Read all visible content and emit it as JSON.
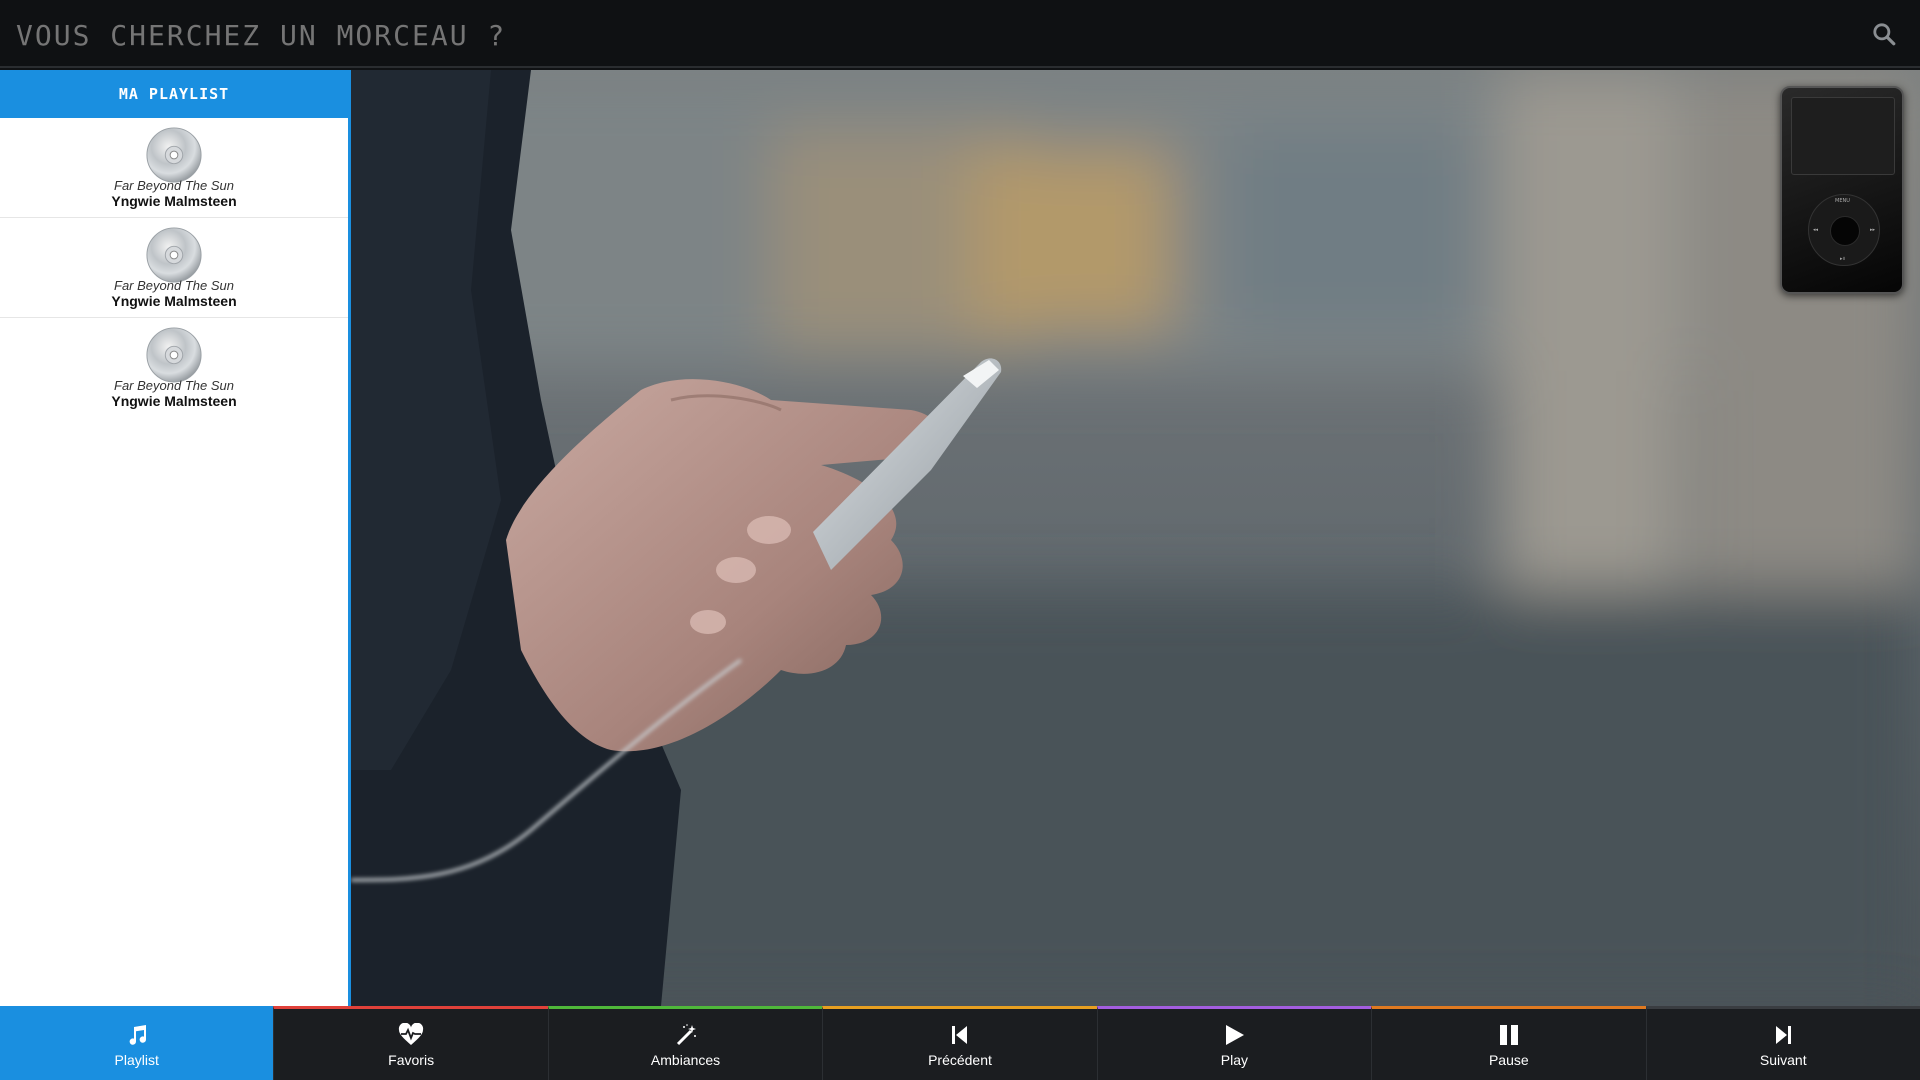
{
  "header": {
    "search_placeholder": "VOUS CHERCHEZ UN MORCEAU ?",
    "search_icon": "search-icon"
  },
  "sidebar": {
    "title": "Ma playlist",
    "tracks": [
      {
        "title": "Far Beyond The Sun",
        "artist": "Yngwie Malmsteen"
      },
      {
        "title": "Far Beyond The Sun",
        "artist": "Yngwie Malmsteen"
      },
      {
        "title": "Far Beyond The Sun",
        "artist": "Yngwie Malmsteen"
      }
    ]
  },
  "ipod": {
    "menu_label": "MENU"
  },
  "nav": [
    {
      "label": "Playlist",
      "icon": "music-note-icon",
      "accent": "#1a8fe0"
    },
    {
      "label": "Favoris",
      "icon": "heart-pulse-icon",
      "accent": "#e0413a"
    },
    {
      "label": "Ambiances",
      "icon": "magic-wand-icon",
      "accent": "#4fb83a"
    },
    {
      "label": "Précédent",
      "icon": "skip-back-icon",
      "accent": "#e8a020"
    },
    {
      "label": "Play",
      "icon": "play-icon",
      "accent": "#a45ee0"
    },
    {
      "label": "Pause",
      "icon": "pause-icon",
      "accent": "#e07a20"
    },
    {
      "label": "Suivant",
      "icon": "skip-forward-icon",
      "accent": "#3a3d41"
    }
  ],
  "colors": {
    "accent": "#1a8fe0",
    "header_bg": "#0f1113",
    "bottom_bg": "#1b1d20"
  }
}
